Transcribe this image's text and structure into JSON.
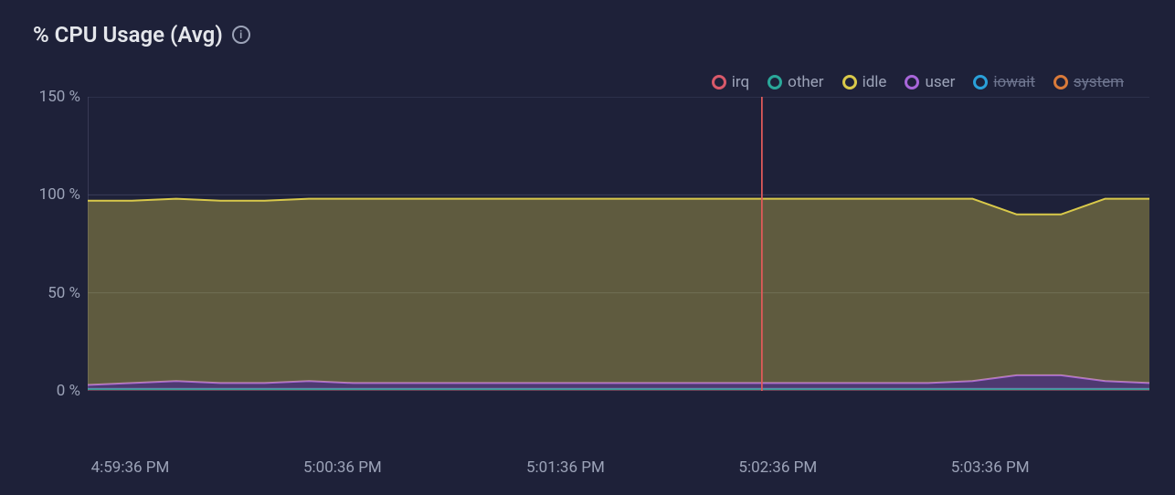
{
  "title": "% CPU Usage (Avg)",
  "info_tooltip": "i",
  "legend": [
    {
      "name": "irq",
      "color": "#d9596a",
      "disabled": false
    },
    {
      "name": "other",
      "color": "#2aa89a",
      "disabled": false
    },
    {
      "name": "idle",
      "color": "#d9c94a",
      "disabled": false
    },
    {
      "name": "user",
      "color": "#a866d9",
      "disabled": false
    },
    {
      "name": "iowait",
      "color": "#2aa0d9",
      "disabled": true
    },
    {
      "name": "system",
      "color": "#d97a3a",
      "disabled": true
    }
  ],
  "y_ticks": [
    "150 %",
    "100 %",
    "50 %",
    "0 %"
  ],
  "x_ticks": [
    "4:59:36 PM",
    "5:00:36 PM",
    "5:01:36 PM",
    "5:02:36 PM",
    "5:03:36 PM"
  ],
  "chart_data": {
    "type": "area",
    "title": "% CPU Usage (Avg)",
    "xlabel": "",
    "ylabel": "",
    "ylim": [
      0,
      150
    ],
    "x_categories": [
      "4:59:36 PM",
      "5:00:36 PM",
      "5:01:36 PM",
      "5:02:36 PM",
      "5:03:36 PM"
    ],
    "cursor_x_fraction": 0.635,
    "series": [
      {
        "name": "irq",
        "color": "#d9596a",
        "values": [
          1,
          1,
          1,
          1,
          1,
          1,
          1,
          1,
          1,
          1,
          1,
          1,
          1,
          1,
          1,
          1,
          1,
          1,
          1,
          1,
          1,
          1,
          1,
          1,
          1
        ]
      },
      {
        "name": "other",
        "color": "#2aa89a",
        "values": [
          0,
          0,
          0,
          0,
          0,
          0,
          0,
          0,
          0,
          0,
          0,
          0,
          0,
          0,
          0,
          0,
          0,
          0,
          0,
          0,
          0,
          0,
          0,
          0,
          0
        ]
      },
      {
        "name": "user",
        "color": "#a866d9",
        "values": [
          2,
          3,
          4,
          3,
          3,
          4,
          3,
          3,
          3,
          3,
          3,
          3,
          3,
          3,
          3,
          3,
          3,
          3,
          3,
          3,
          4,
          7,
          7,
          4,
          3
        ]
      },
      {
        "name": "idle",
        "color": "#d9c94a",
        "values": [
          94,
          93,
          93,
          93,
          93,
          93,
          94,
          94,
          94,
          94,
          94,
          94,
          94,
          94,
          94,
          94,
          94,
          94,
          94,
          94,
          93,
          82,
          82,
          93,
          94
        ]
      }
    ]
  }
}
